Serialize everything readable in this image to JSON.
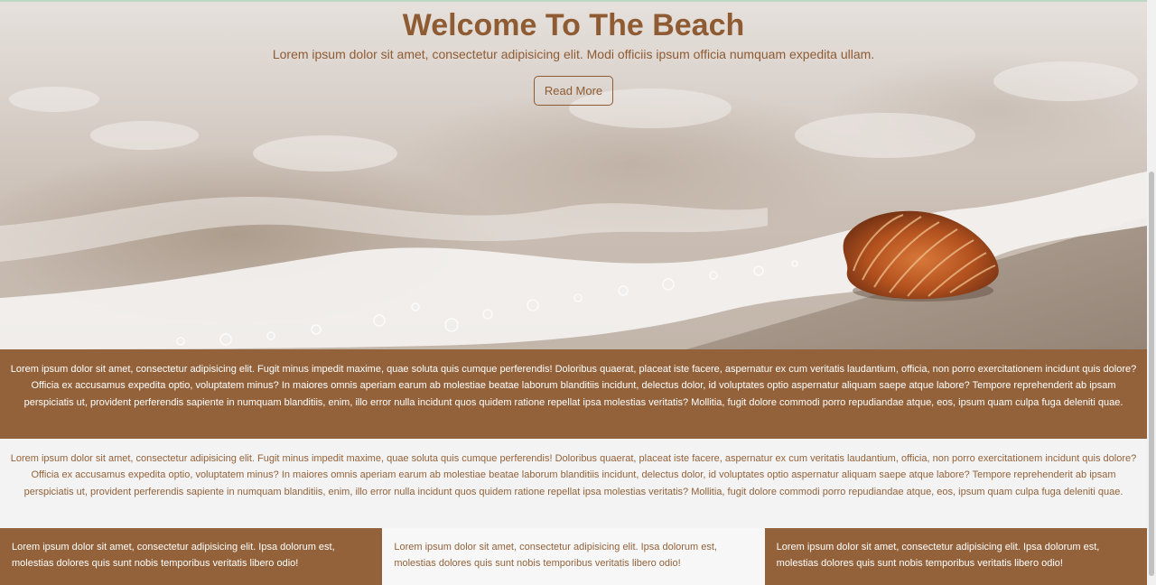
{
  "hero": {
    "title": "Welcome To The Beach",
    "subtitle": "Lorem ipsum dolor sit amet, consectetur adipisicing elit. Modi officiis ipsum officia numquam expedita ullam.",
    "button_label": "Read More",
    "image": "beach-seashell-foam"
  },
  "sections": {
    "paragraph_1": "Lorem ipsum dolor sit amet, consectetur adipisicing elit. Fugit minus impedit maxime, quae soluta quis cumque perferendis! Doloribus quaerat, placeat iste facere, aspernatur ex cum veritatis laudantium, officia, non porro exercitationem incidunt quis dolore? Officia ex accusamus expedita optio, voluptatem minus? In maiores omnis aperiam earum ab molestiae beatae laborum blanditiis incidunt, delectus dolor, id voluptates optio aspernatur aliquam saepe atque labore? Tempore reprehenderit ab ipsam perspiciatis ut, provident perferendis sapiente in numquam blanditiis, enim, illo error nulla incidunt quos quidem ratione repellat ipsa molestias veritatis? Mollitia, fugit dolore commodi porro repudiandae atque, eos, ipsum quam culpa fuga deleniti quae.",
    "paragraph_2": "Lorem ipsum dolor sit amet, consectetur adipisicing elit. Fugit minus impedit maxime, quae soluta quis cumque perferendis! Doloribus quaerat, placeat iste facere, aspernatur ex cum veritatis laudantium, officia, non porro exercitationem incidunt quis dolore? Officia ex accusamus expedita optio, voluptatem minus? In maiores omnis aperiam earum ab molestiae beatae laborum blanditiis incidunt, delectus dolor, id voluptates optio aspernatur aliquam saepe atque labore? Tempore reprehenderit ab ipsam perspiciatis ut, provident perferendis sapiente in numquam blanditiis, enim, illo error nulla incidunt quos quidem ratione repellat ipsa molestias veritatis? Mollitia, fugit dolore commodi porro repudiandae atque, eos, ipsum quam culpa fuga deleniti quae."
  },
  "columns": [
    {
      "text": "Lorem ipsum dolor sit amet, consectetur adipisicing elit. Ipsa dolorum est, molestias dolores quis sunt nobis temporibus veritatis libero odio!"
    },
    {
      "text": "Lorem ipsum dolor sit amet, consectetur adipisicing elit. Ipsa dolorum est, molestias dolores quis sunt nobis temporibus veritatis libero odio!"
    },
    {
      "text": "Lorem ipsum dolor sit amet, consectetur adipisicing elit. Ipsa dolorum est, molestias dolores quis sunt nobis temporibus veritatis libero odio!"
    }
  ],
  "colors": {
    "brand_brown": "#93623a",
    "title_brown": "#8e5b33",
    "light_bg": "#f3f3f3",
    "white_text": "#ffffff"
  }
}
